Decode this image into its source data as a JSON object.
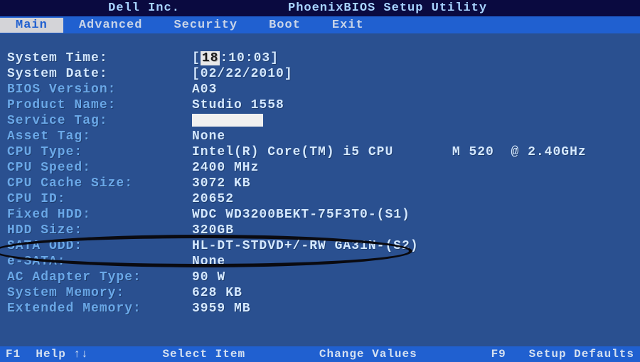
{
  "header": {
    "manufacturer": "Dell Inc.",
    "title": "PhoenixBIOS Setup Utility"
  },
  "menu": {
    "tabs": [
      "Main",
      "Advanced",
      "Security",
      "Boot",
      "Exit"
    ],
    "active_index": 0
  },
  "fields": {
    "system_time": {
      "label": "System Time:",
      "hour": "18",
      "rest": ":10:03"
    },
    "system_date": {
      "label": "System Date:",
      "value": "[02/22/2010]"
    },
    "bios_version": {
      "label": "BIOS Version:",
      "value": "A03"
    },
    "product_name": {
      "label": "Product Name:",
      "value": "Studio 1558"
    },
    "service_tag": {
      "label": "Service Tag:",
      "value": ""
    },
    "asset_tag": {
      "label": "Asset Tag:",
      "value": "None"
    },
    "cpu_type": {
      "label": "CPU Type:",
      "value": "Intel(R) Core(TM) i5 CPU       M 520  @ 2.40GHz"
    },
    "cpu_speed": {
      "label": "CPU Speed:",
      "value": "2400 MHz"
    },
    "cpu_cache": {
      "label": "CPU Cache Size:",
      "value": "3072 KB"
    },
    "cpu_id": {
      "label": "CPU ID:",
      "value": "20652"
    },
    "fixed_hdd": {
      "label": "Fixed HDD:",
      "value": "WDC WD3200BEKT-75F3T0-(S1)"
    },
    "hdd_size": {
      "label": "HDD Size:",
      "value": "320GB"
    },
    "sata_odd": {
      "label": "SATA ODD:",
      "value": "HL-DT-STDVD+/-RW GA31N-(S2)"
    },
    "esata": {
      "label": "e-SATA:",
      "value": "None"
    },
    "ac_adapter": {
      "label": "AC Adapter Type:",
      "value": "90 W"
    },
    "system_memory": {
      "label": "System Memory:",
      "value": "628 KB"
    },
    "extended_memory": {
      "label": "Extended Memory:",
      "value": "3959 MB"
    }
  },
  "footer": {
    "f1": "F1  Help ↑↓",
    "select_item": "Select Item",
    "change_values": "Change Values",
    "f9": "F9   Setup Defaults"
  }
}
